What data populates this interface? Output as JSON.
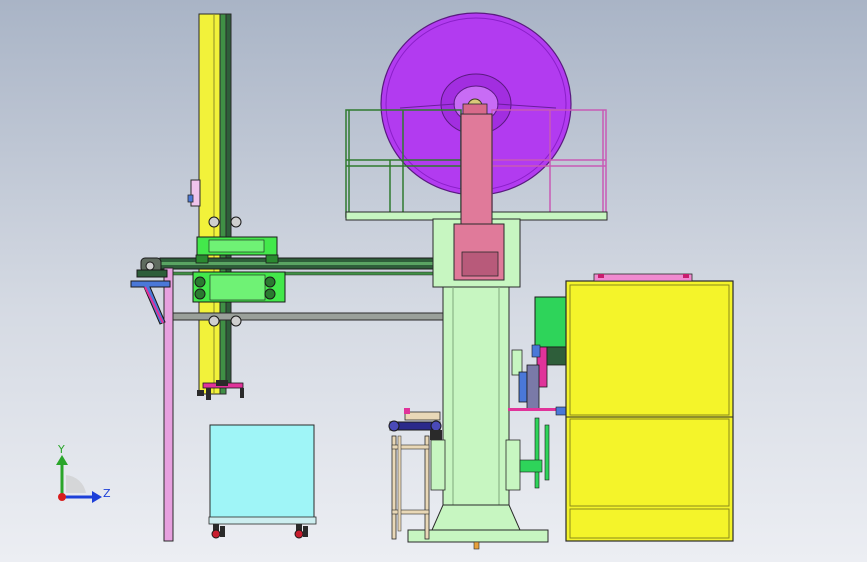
{
  "triad": {
    "y_label": "Y",
    "z_label": "Z",
    "y_color": "#2aa52a",
    "z_color": "#1d3fd8",
    "origin_color": "#d81d1d"
  },
  "colors": {
    "flywheel": "#b23bf0",
    "flywheel_rim": "#8a1fc9",
    "press_frame": "#c7f6c1",
    "ram": "#e07a9a",
    "guard_rail": "#2f7a2f",
    "cabinet": "#f4f42a",
    "cart": "#9ff5f7",
    "mast": "#f2f23a",
    "carriage": "#43e84b",
    "beam": "#2e5e3a",
    "support_leg": "#e7a0df",
    "bracket": "#4a78d8",
    "motor_box": "#2ed45a",
    "stand": "#e9d8b7",
    "conveyor_roller": "#2a2a8a",
    "magenta_parts": "#e0339a",
    "edge": "#2a2a2a"
  }
}
